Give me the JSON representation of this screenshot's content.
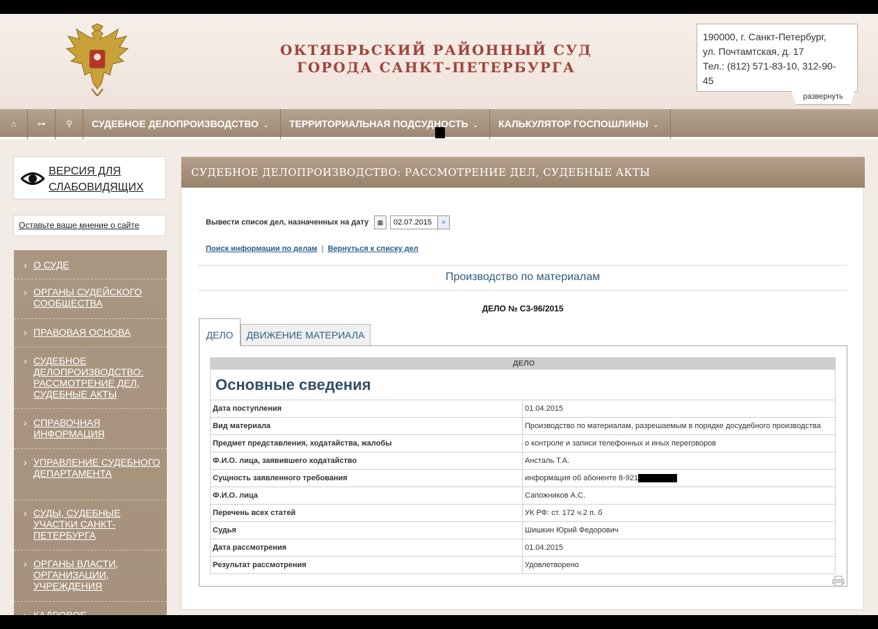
{
  "header": {
    "court_title_line1": "ОКТЯБРЬСКИЙ РАЙОННЫЙ СУД",
    "court_title_line2": "ГОРОДА САНКТ-ПЕТЕРБУРГА",
    "address_line1": "190000, г. Санкт-Петербург,",
    "address_line2": "ул. Почтамтская, д. 17",
    "address_line3": "Тел.: (812) 571-83-10, 312-90-",
    "address_line4": "45",
    "expand_label": "развернуть"
  },
  "navbar": {
    "icons": [
      "home-icon",
      "sitemap-icon",
      "search-icon"
    ],
    "items": [
      {
        "label": "СУДЕБНОЕ ДЕЛОПРОИЗВОДСТВО"
      },
      {
        "label": "ТЕРРИТОРИАЛЬНАЯ ПОДСУДНОСТЬ"
      },
      {
        "label": "КАЛЬКУЛЯТОР ГОСПОШЛИНЫ"
      }
    ]
  },
  "sidebar": {
    "vision_label": "Версия для слабовидящих",
    "feedback_label": "Оставьте ваше мнение о сайте",
    "items": [
      {
        "label": "О СУДЕ"
      },
      {
        "label": "ОРГАНЫ СУДЕЙСКОГО СООБЩЕСТВА"
      },
      {
        "label": "ПРАВОВАЯ ОСНОВА"
      },
      {
        "label": "СУДЕБНОЕ ДЕЛОПРОИЗВОДСТВО: РАССМОТРЕНИЕ ДЕЛ, СУДЕБНЫЕ АКТЫ"
      },
      {
        "label": "СПРАВОЧНАЯ ИНФОРМАЦИЯ"
      },
      {
        "label": "УПРАВЛЕНИЕ СУДЕБНОГО ДЕПАРТАМЕНТА"
      },
      {
        "label": "СУДЫ, СУДЕБНЫЕ УЧАСТКИ САНКТ-ПЕТЕРБУРГА"
      },
      {
        "label": "ОРГАНЫ ВЛАСТИ, ОРГАНИЗАЦИИ, УЧРЕЖДЕНИЯ"
      },
      {
        "label": "КАДРОВОЕ"
      }
    ]
  },
  "main": {
    "heading": "СУДЕБНОЕ ДЕЛОПРОИЗВОДСТВО: РАССМОТРЕНИЕ ДЕЛ, СУДЕБНЫЕ АКТЫ",
    "date_label": "Вывести список дел, назначенных на дату",
    "date_value": "02.07.2015",
    "link_search": "Поиск информации по делам",
    "link_separator": "|",
    "link_back": "Вернуться к списку дел",
    "section_title": "Производство по материалам",
    "case_number": "ДЕЛО № С3-96/2015",
    "tabs": [
      {
        "label": "ДЕЛО"
      },
      {
        "label": "ДВИЖЕНИЕ МАТЕРИАЛА"
      }
    ],
    "table": {
      "head": "ДЕЛО",
      "subhead": "Основные сведения",
      "rows": [
        {
          "label": "Дата поступления",
          "value": "01.04.2015"
        },
        {
          "label": "Вид материала",
          "value": "Производство по материалам, разрешаемым в порядке досудебного производства"
        },
        {
          "label": "Предмет представления, ходатайства, жалобы",
          "value": "о контроле и записи телефонных и иных переговоров"
        },
        {
          "label": "Ф.И.О. лица, заявившего ходатайство",
          "value": "Ансталь Т.А."
        },
        {
          "label": "Сущность заявленного требования",
          "value": "информация об абоненте 8-921"
        },
        {
          "label": "Ф.И.О. лица",
          "value": "Сапожников А.С."
        },
        {
          "label": "Перечень всех статей",
          "value": "УК РФ: ст. 172 ч.2 п. б"
        },
        {
          "label": "Судья",
          "value": "Шишкин Юрий Федорович"
        },
        {
          "label": "Дата рассмотрения",
          "value": "01.04.2015"
        },
        {
          "label": "Результат рассмотрения",
          "value": "Удовлетворено"
        }
      ]
    }
  },
  "colors": {
    "brand_brown": "#a6927c",
    "title_red": "#a0443a",
    "link_blue": "#2b5d8a"
  }
}
